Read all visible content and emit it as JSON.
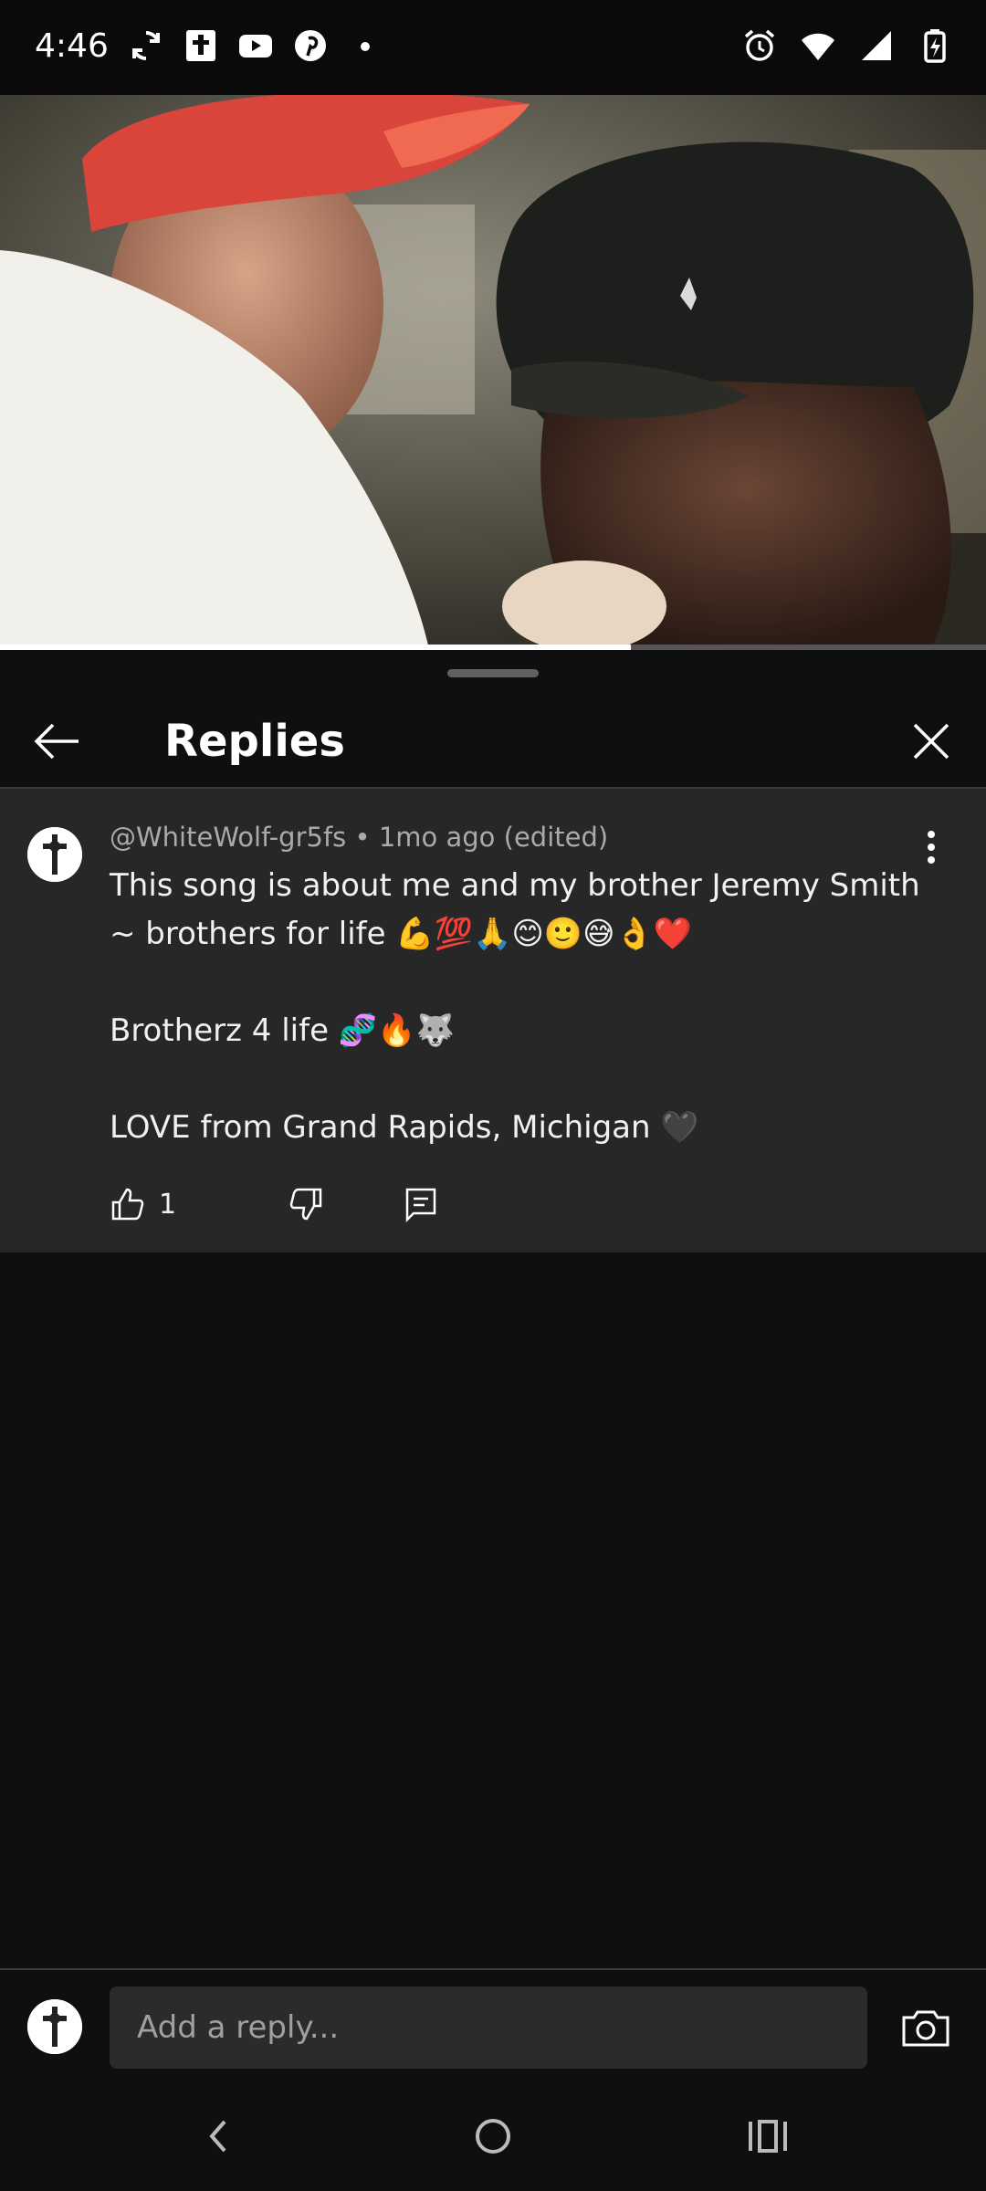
{
  "status_bar": {
    "time": "4:46",
    "left_icons": [
      "sync-icon",
      "bible-app-icon",
      "youtube-icon",
      "pinterest-icon",
      "dot-icon"
    ],
    "right_icons": [
      "alarm-icon",
      "wifi-icon",
      "signal-icon",
      "battery-charging-icon"
    ]
  },
  "video": {
    "progress_fraction": 0.64
  },
  "sheet": {
    "title": "Replies"
  },
  "comment": {
    "meta": "@WhiteWolf-gr5fs • 1mo ago (edited)",
    "text": "This song is about me and my brother Jeremy Smith ~ brothers for life 💪💯🙏😊🙂😅👌❤️\n\nBrotherz 4 life 🧬🔥🐺\n\nLOVE from Grand Rapids, Michigan 🖤",
    "like_count": "1"
  },
  "reply_bar": {
    "placeholder": "Add a reply..."
  },
  "colors": {
    "background": "#0f0f0f",
    "comment_background": "#272727",
    "secondary_text": "#aaaaaa"
  }
}
